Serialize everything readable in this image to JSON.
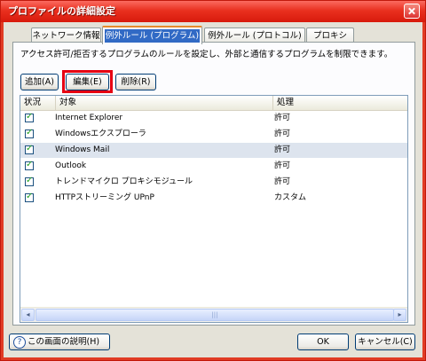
{
  "window": {
    "title": "プロファイルの詳細設定"
  },
  "tabs": [
    {
      "label": "ネットワーク情報"
    },
    {
      "label": "例外ルール (プログラム)"
    },
    {
      "label": "例外ルール (プロトコル)"
    },
    {
      "label": "プロキシ"
    }
  ],
  "description": "アクセス許可/拒否するプログラムのルールを設定し、外部と通信するプログラムを制限できます。",
  "buttons": {
    "add": "追加(A)",
    "edit": "編集(E)",
    "delete": "削除(R)"
  },
  "columns": {
    "status": "状況",
    "target": "対象",
    "action": "処理"
  },
  "rows": [
    {
      "checked": true,
      "target": "Internet Explorer",
      "action": "許可"
    },
    {
      "checked": true,
      "target": "Windowsエクスプローラ",
      "action": "許可"
    },
    {
      "checked": true,
      "target": "Windows Mail",
      "action": "許可"
    },
    {
      "checked": true,
      "target": "Outlook",
      "action": "許可"
    },
    {
      "checked": true,
      "target": "トレンドマイクロ プロキシモジュール",
      "action": "許可"
    },
    {
      "checked": true,
      "target": "HTTPストリーミング UPnP",
      "action": "カスタム"
    }
  ],
  "scrollbar": {
    "left": "◂",
    "right": "▸",
    "grip": "|||"
  },
  "footer": {
    "help_icon": "?",
    "help": "この画面の説明(H)",
    "ok": "OK",
    "cancel": "キャンセル(C)"
  }
}
